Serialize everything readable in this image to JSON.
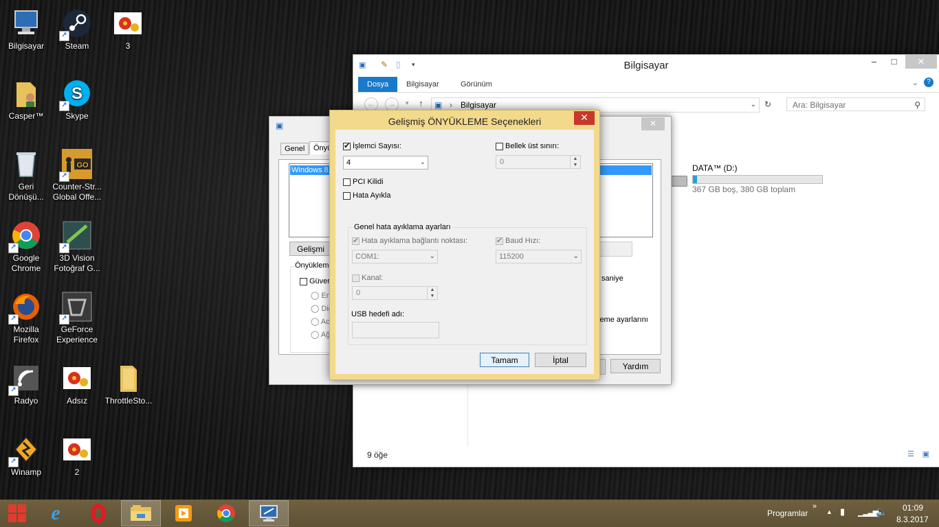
{
  "desktop": {
    "icons": [
      {
        "label": "Bilgisayar",
        "icon": "computer-icon"
      },
      {
        "label": "Steam",
        "icon": "steam-icon"
      },
      {
        "label": "3",
        "icon": "image-file-icon"
      },
      {
        "label": "Casper™",
        "icon": "user-folder-icon"
      },
      {
        "label": "Skype",
        "icon": "skype-icon"
      },
      {
        "label": "Geri Dönüşü...",
        "icon": "recycle-bin-icon"
      },
      {
        "label": "Counter-Str... Global Offe...",
        "icon": "csgo-icon"
      },
      {
        "label": "Google Chrome",
        "icon": "chrome-icon"
      },
      {
        "label": "3D Vision Fotoğraf G...",
        "icon": "3d-vision-icon"
      },
      {
        "label": "Mozilla Firefox",
        "icon": "firefox-icon"
      },
      {
        "label": "GeForce Experience",
        "icon": "geforce-icon"
      },
      {
        "label": "Radyo",
        "icon": "radio-icon"
      },
      {
        "label": "Adsız",
        "icon": "image-file-icon"
      },
      {
        "label": "ThrottleSto...",
        "icon": "folder-icon"
      },
      {
        "label": "Winamp",
        "icon": "winamp-icon"
      },
      {
        "label": "2",
        "icon": "image-file-icon"
      }
    ]
  },
  "explorer": {
    "title": "Bilgisayar",
    "tabs": [
      "Dosya",
      "Bilgisayar",
      "Görünüm"
    ],
    "address": "Bilgisayar",
    "search_placeholder": "Ara: Bilgisayar",
    "drive": {
      "name": "DATA™ (D:)",
      "info": "367 GB boş, 380 GB toplam",
      "used_fraction": 0.034
    },
    "status": "9 öğe"
  },
  "sysconfig": {
    "tabs": [
      "Genel",
      "Önyü"
    ],
    "os_item": "Windows 8.",
    "advanced_btn": "Gelişmi",
    "boot_group": "Önyükleme",
    "safe_boot": "Güver",
    "radios": [
      "En",
      "Diğ",
      "Ac",
      "Ağ"
    ],
    "timeout_unit": "saniye",
    "persist_text": "leme ayarlarını",
    "help_btn": "Yardım"
  },
  "dialog": {
    "title": "Gelişmiş ÖNYÜKLEME Seçenekleri",
    "num_proc_label": "İşlemci Sayısı:",
    "num_proc_value": "4",
    "max_mem_label": "Bellek üst sınırı:",
    "max_mem_value": "0",
    "pci_lock_label": "PCI Kilidi",
    "debug_label": "Hata Ayıkla",
    "group_label": "Genel hata ayıklama ayarları",
    "debug_port_label": "Hata ayıklama bağlantı noktası:",
    "debug_port_value": "COM1:",
    "baud_label": "Baud Hızı:",
    "baud_value": "115200",
    "channel_label": "Kanal:",
    "channel_value": "0",
    "usb_label": "USB hedefi adı:",
    "ok_label": "Tamam",
    "cancel_label": "İptal"
  },
  "taskbar": {
    "programs_label": "Programlar",
    "time": "01:09",
    "date": "8.3.2017"
  },
  "colors": {
    "accent": "#1979ca",
    "dialog_frame": "#f3d98b",
    "close_red": "#c7372c",
    "taskbar": "#6a5c3b"
  }
}
